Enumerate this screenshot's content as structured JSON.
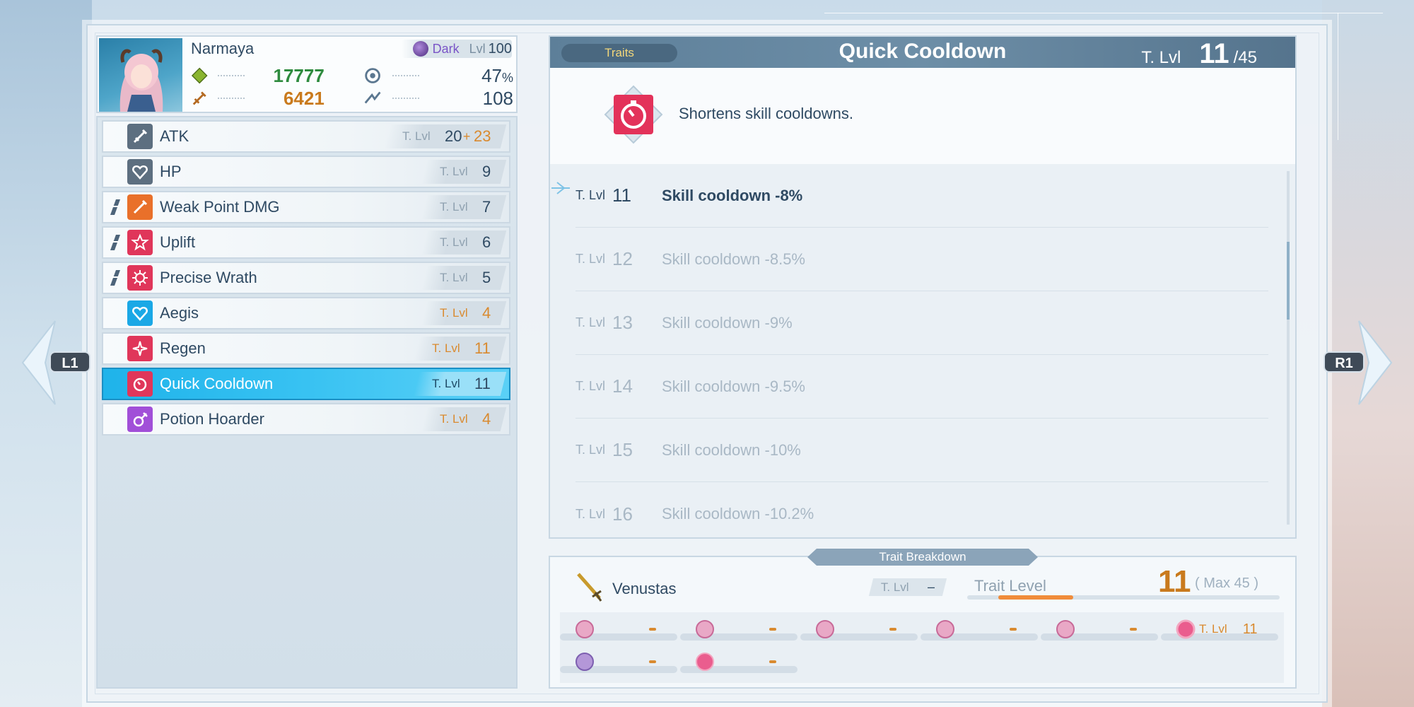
{
  "nav": {
    "left_key": "L1",
    "right_key": "R1"
  },
  "character": {
    "name": "Narmaya",
    "element": "Dark",
    "level_label": "Lvl",
    "level": "100",
    "hp": "17777",
    "atk": "6421",
    "crit_rate": "47",
    "crit_unit": "%",
    "stun_power": "108"
  },
  "traits_list": [
    {
      "name": "ATK",
      "lvl_label": "T. Lvl",
      "value": "20",
      "bonus_sign": "+",
      "bonus": "23",
      "icon": "sword-icon",
      "locked": false,
      "highlight": false
    },
    {
      "name": "HP",
      "lvl_label": "T. Lvl",
      "value": "9",
      "icon": "heart-icon",
      "locked": false,
      "highlight": false
    },
    {
      "name": "Weak Point DMG",
      "lvl_label": "T. Lvl",
      "value": "7",
      "icon": "weak-point-icon",
      "locked": true,
      "highlight": false
    },
    {
      "name": "Uplift",
      "lvl_label": "T. Lvl",
      "value": "6",
      "icon": "star-icon",
      "locked": true,
      "highlight": false
    },
    {
      "name": "Precise Wrath",
      "lvl_label": "T. Lvl",
      "value": "5",
      "icon": "gear-burst-icon",
      "locked": true,
      "highlight": false
    },
    {
      "name": "Aegis",
      "lvl_label": "T. Lvl",
      "value": "4",
      "icon": "shield-heart-icon",
      "locked": false,
      "highlight": true
    },
    {
      "name": "Regen",
      "lvl_label": "T. Lvl",
      "value": "11",
      "icon": "sparkle-icon",
      "locked": false,
      "highlight": true
    },
    {
      "name": "Quick Cooldown",
      "lvl_label": "T. Lvl",
      "value": "11",
      "icon": "clock-icon",
      "locked": false,
      "highlight": true,
      "selected": true
    },
    {
      "name": "Potion Hoarder",
      "lvl_label": "T. Lvl",
      "value": "4",
      "icon": "potion-icon",
      "locked": false,
      "highlight": true
    }
  ],
  "detail": {
    "tab_label": "Traits",
    "title": "Quick Cooldown",
    "tlvl_label": "T. Lvl",
    "tlvl_current": "11",
    "tlvl_max": "/45",
    "description": "Shortens skill cooldowns.",
    "levels": [
      {
        "label": "T. Lvl",
        "num": "11",
        "desc": "Skill cooldown -8%",
        "current": true
      },
      {
        "label": "T. Lvl",
        "num": "12",
        "desc": "Skill cooldown -8.5%"
      },
      {
        "label": "T. Lvl",
        "num": "13",
        "desc": "Skill cooldown -9%"
      },
      {
        "label": "T. Lvl",
        "num": "14",
        "desc": "Skill cooldown -9.5%"
      },
      {
        "label": "T. Lvl",
        "num": "15",
        "desc": "Skill cooldown -10%"
      },
      {
        "label": "T. Lvl",
        "num": "16",
        "desc": "Skill cooldown -10.2%"
      }
    ]
  },
  "breakdown": {
    "tab_label": "Trait Breakdown",
    "weapon_name": "Venustas",
    "tlvl_label": "T. Lvl",
    "tlvl_value": "–",
    "trait_level_label": "Trait Level",
    "trait_level_value": "11",
    "max_text": "( Max 45 )",
    "trait_level_fraction": 0.24,
    "sigil_tlvl_label": "T. Lvl",
    "sigil_tlvl_value": "11"
  }
}
